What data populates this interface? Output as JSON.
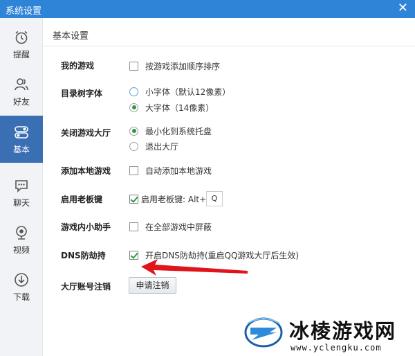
{
  "window": {
    "title": "系统设置",
    "close_glyph": "✕"
  },
  "sidebar": {
    "items": [
      {
        "label": "提醒",
        "icon": "alarm-clock-icon",
        "active": false
      },
      {
        "label": "好友",
        "icon": "friends-icon",
        "active": false
      },
      {
        "label": "基本",
        "icon": "toggle-settings-icon",
        "active": true
      },
      {
        "label": "聊天",
        "icon": "chat-bubble-icon",
        "active": false
      },
      {
        "label": "视频",
        "icon": "webcam-icon",
        "active": false
      },
      {
        "label": "下载",
        "icon": "download-icon",
        "active": false
      }
    ]
  },
  "main": {
    "section_title": "基本设置",
    "rows": {
      "my_games": {
        "label": "我的游戏",
        "options": [
          {
            "text": "按游戏添加顺序排序",
            "type": "checkbox",
            "checked": false
          }
        ]
      },
      "tree_font": {
        "label": "目录树字体",
        "options": [
          {
            "text": "小字体（默认12像素）",
            "type": "radio",
            "checked": false
          },
          {
            "text": "大字体（14像素）",
            "type": "radio",
            "checked": true
          }
        ]
      },
      "close_hall": {
        "label": "关闭游戏大厅",
        "options": [
          {
            "text": "最小化到系统托盘",
            "type": "radio",
            "checked": true
          },
          {
            "text": "退出大厅",
            "type": "radio",
            "checked": false
          }
        ]
      },
      "add_local": {
        "label": "添加本地游戏",
        "options": [
          {
            "text": "自动添加本地游戏",
            "type": "checkbox",
            "checked": false
          }
        ]
      },
      "boss_key": {
        "label": "启用老板键",
        "options": [
          {
            "text": "启用老板键: Alt+",
            "type": "checkbox",
            "checked": true
          }
        ],
        "key_value": "Q"
      },
      "in_game_helper": {
        "label": "游戏内小助手",
        "options": [
          {
            "text": "在全部游戏中屏蔽",
            "type": "checkbox",
            "checked": false
          }
        ]
      },
      "dns": {
        "label": "DNS防劫持",
        "options": [
          {
            "text": "开启DNS防劫持(重启QQ游戏大厅后生效)",
            "type": "checkbox",
            "checked": true
          }
        ]
      },
      "account_cancel": {
        "label": "大厅账号注销",
        "button_label": "申请注销"
      }
    }
  },
  "watermark": {
    "title": "冰棱游戏网",
    "url": "www.yclengku.com"
  },
  "colors": {
    "titlebar": "#2e84d6",
    "active_nav": "#3b6fb3",
    "check_green": "#2f9b3a",
    "arrow_red": "#e0141b"
  }
}
